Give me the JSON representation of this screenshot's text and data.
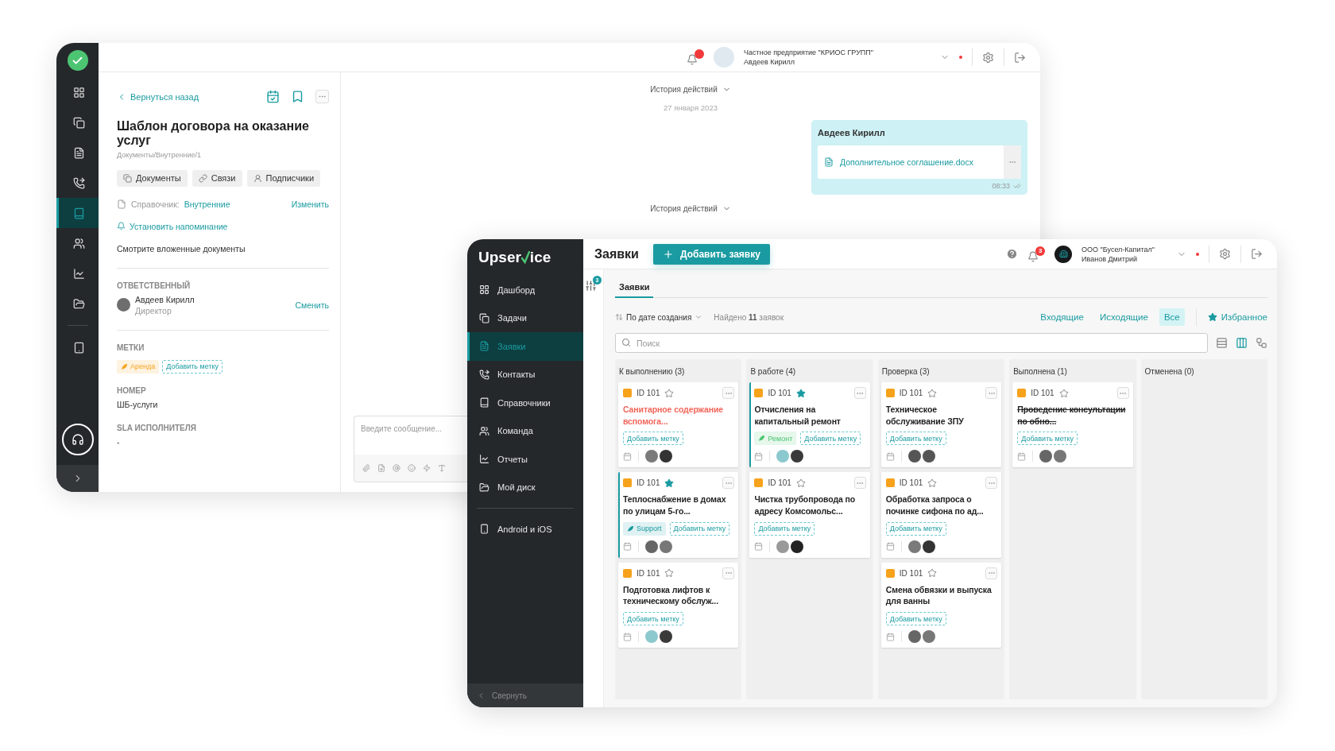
{
  "back_window": {
    "sidebar": {
      "items": [
        {
          "selected": false
        },
        {
          "selected": false
        },
        {
          "selected": false
        },
        {
          "selected": false
        },
        {
          "selected": true
        },
        {
          "selected": false
        },
        {
          "selected": false
        },
        {
          "selected": false
        }
      ],
      "apps": [
        {
          "selected": false
        }
      ]
    },
    "header": {
      "company": "Частное предприятие \"КРИОС ГРУПП\"",
      "user": "Авдеев Кирилл"
    },
    "document": {
      "back_link": "Вернуться назад",
      "title": "Шаблон договора на оказание услуг",
      "path": "Документы/Внутренние/1",
      "buttons": [
        "Документы",
        "Связи",
        "Подписчики"
      ],
      "directory": {
        "label": "Справочник:",
        "value": "Внутренние",
        "action": "Изменить"
      },
      "reminder": "Установить напоминание",
      "note": "Смотрите вложенные документы",
      "responsible": {
        "heading": "ОТВЕТСТВЕННЫЙ",
        "name": "Авдеев Кирилл",
        "role": "Директор",
        "action": "Сменить"
      },
      "tags": {
        "heading": "МЕТКИ",
        "items": [
          {
            "label": "Аренда",
            "color": "#f5a623"
          }
        ],
        "add": "Добавить метку"
      },
      "number": {
        "heading": "НОМЕР",
        "value": "ШБ-услуги"
      },
      "sla": {
        "heading": "SLA ИСПОЛНИТЕЛЯ",
        "value": "-"
      }
    },
    "chat": {
      "history_top": "История действий",
      "date": "27 января 2023",
      "message": {
        "author": "Авдеев Кирилл",
        "file": "Дополнительное соглашение.docx",
        "time": "08:33"
      },
      "history_bottom": "История действий",
      "composer": {
        "placeholder": "Введите сообщение..."
      }
    }
  },
  "front_window": {
    "sidebar": {
      "logo": {
        "before": "Upser",
        "after": "ice"
      },
      "items": [
        {
          "label": "Дашборд",
          "selected": false
        },
        {
          "label": "Задачи",
          "selected": false
        },
        {
          "label": "Заявки",
          "selected": true
        },
        {
          "label": "Контакты",
          "selected": false
        },
        {
          "label": "Справочники",
          "selected": false
        },
        {
          "label": "Команда",
          "selected": false
        },
        {
          "label": "Отчеты",
          "selected": false
        },
        {
          "label": "Мой диск",
          "selected": false
        }
      ],
      "apps": [
        {
          "label": "Android и iOS",
          "selected": false
        }
      ],
      "collapse": "Свернуть"
    },
    "header": {
      "title": "Заявки",
      "add_button": "Добавить заявку",
      "notifications": "3",
      "company": "ООО \"Бусел-Капитал\"",
      "user": "Иванов Дмитрий"
    },
    "filter_badge": "3",
    "tabs": [
      {
        "label": "Заявки",
        "selected": true
      }
    ],
    "sort": "По дате создания",
    "found": "Найдено **11** заявок",
    "filters": [
      {
        "label": "Входящие",
        "selected": false
      },
      {
        "label": "Исходящие",
        "selected": false
      },
      {
        "label": "Все",
        "selected": true
      }
    ],
    "favorites": "Избранное",
    "search": {
      "placeholder": "Поиск"
    },
    "views": [
      {
        "selected": false
      },
      {
        "selected": true
      },
      {
        "selected": false
      }
    ],
    "columns": [
      {
        "title": "К выполнению (3)",
        "cards": [
          {
            "id": "ID 101",
            "starred": false,
            "kind": "overdue",
            "accent": false,
            "title": "Санитарное содержание вспомога...",
            "add_tag": "Добавить метку"
          },
          {
            "id": "ID 101",
            "starred": true,
            "kind": "normal",
            "accent": true,
            "title": "Теплоснабжение в домах по улицам 5-го...",
            "tags": [
              {
                "label": "Support",
                "color": "#1a9ba1"
              }
            ],
            "add_tag": "Добавить метку"
          },
          {
            "id": "ID 101",
            "starred": false,
            "kind": "normal",
            "accent": false,
            "title": "Подготовка лифтов к техническому обслуж...",
            "add_tag": "Добавить метку"
          }
        ]
      },
      {
        "title": "В работе (4)",
        "cards": [
          {
            "id": "ID 101",
            "starred": true,
            "kind": "normal",
            "accent": true,
            "title": "Отчисления на капитальный ремонт",
            "tags": [
              {
                "label": "Ремонт",
                "color": "#4cc472"
              }
            ],
            "add_tag": "Добавить метку"
          },
          {
            "id": "ID 101",
            "starred": false,
            "kind": "normal",
            "accent": false,
            "title": "Чистка трубопровода по адресу Комсомольс...",
            "add_tag": "Добавить метку"
          }
        ]
      },
      {
        "title": "Проверка (3)",
        "cards": [
          {
            "id": "ID 101",
            "starred": false,
            "kind": "normal",
            "accent": false,
            "title": "Техническое обслуживание ЗПУ",
            "add_tag": "Добавить метку"
          },
          {
            "id": "ID 101",
            "starred": false,
            "kind": "normal",
            "accent": false,
            "title": "Обработка запроса о починке сифона по ад...",
            "add_tag": "Добавить метку"
          },
          {
            "id": "ID 101",
            "starred": false,
            "kind": "normal",
            "accent": false,
            "title": "Смена обвязки и выпуска для ванны",
            "add_tag": "Добавить метку"
          }
        ]
      },
      {
        "title": "Выполнена (1)",
        "cards": [
          {
            "id": "ID 101",
            "starred": false,
            "kind": "done",
            "accent": false,
            "title": "Проведение консультации по обно...",
            "add_tag": "Добавить метку"
          }
        ]
      },
      {
        "title": "Отменена (0)"
      }
    ]
  }
}
